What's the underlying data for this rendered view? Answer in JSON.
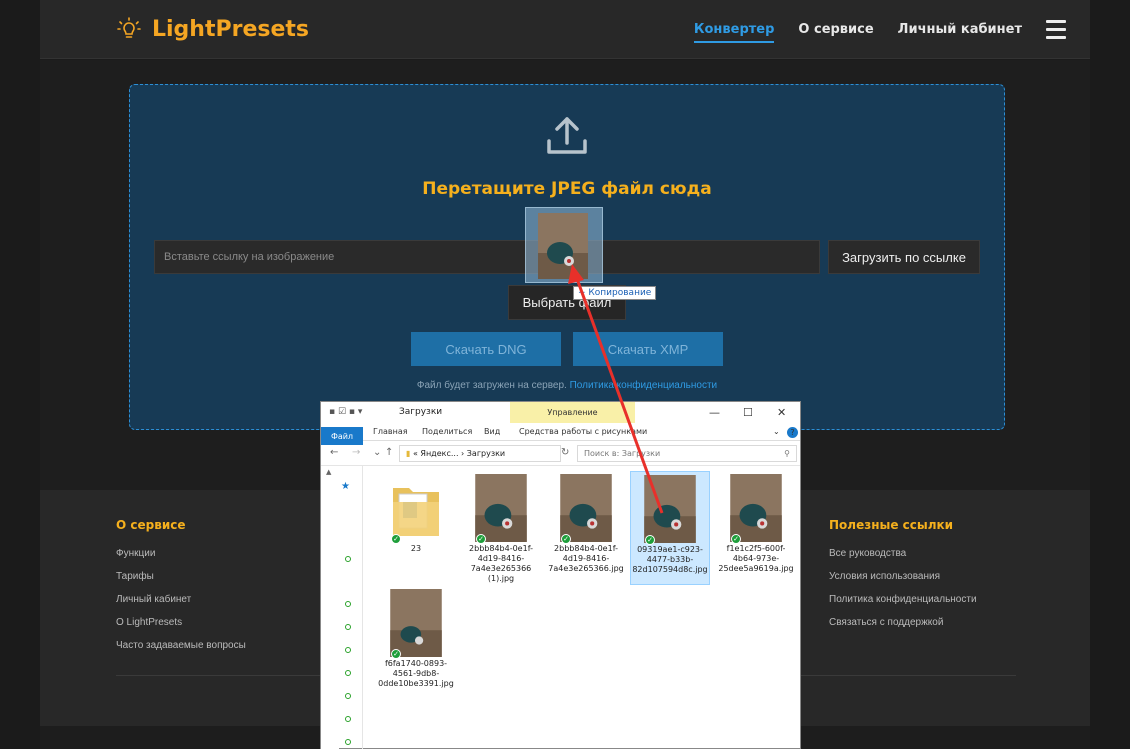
{
  "header": {
    "logo_text": "LightPresets",
    "nav": [
      "Конвертер",
      "О сервисе",
      "Личный кабинет"
    ]
  },
  "dropzone": {
    "title": "Перетащите JPEG файл сюда",
    "url_placeholder": "Вставьте ссылку на изображение",
    "url_button": "Загрузить по ссылке",
    "choose_button": "Выбрать файл",
    "download_dng": "Скачать DNG",
    "download_xmp": "Скачать XMP",
    "notice_text": "Файл будет загружен на сервер.",
    "notice_link": "Политика конфиденциальности"
  },
  "drag": {
    "tooltip": "+ Копирование"
  },
  "footer": {
    "col1_title": "О сервисе",
    "col1_links": [
      "Функции",
      "Тарифы",
      "Личный кабинет",
      "О LightPresets",
      "Часто задаваемые вопросы"
    ],
    "col2_title": "Полезные ссылки",
    "col2_links": [
      "Все руководства",
      "Условия использования",
      "Политика конфиденциальности",
      "Связаться с поддержкой"
    ]
  },
  "explorer": {
    "title": "Загрузки",
    "manage_tab": "Управление",
    "ribbon_tabs": [
      "Файл",
      "Главная",
      "Поделиться",
      "Вид"
    ],
    "ribbon_context": "Средства работы с рисунками",
    "address": [
      "Яндекс...",
      "Загрузки"
    ],
    "search_placeholder": "Поиск в: Загрузки",
    "files": [
      {
        "name": "23",
        "type": "folder"
      },
      {
        "name": "2bbb84b4-0e1f-4d19-8416-7a4e3e265366 (1).jpg",
        "type": "image"
      },
      {
        "name": "2bbb84b4-0e1f-4d19-8416-7a4e3e265366.jpg",
        "type": "image"
      },
      {
        "name": "09319ae1-c923-4477-b33b-82d107594d8c.jpg",
        "type": "image",
        "selected": true
      },
      {
        "name": "f1e1c2f5-600f-4b64-973e-25dee5a9619a.jpg",
        "type": "image"
      },
      {
        "name": "f6fa1740-0893-4561-9db8-0dde10be3391.jpg",
        "type": "image"
      }
    ]
  },
  "colors": {
    "accent": "#f5b01d",
    "link": "#2f9be4",
    "drop_bg": "#173a55",
    "arrow": "#e8302a"
  }
}
